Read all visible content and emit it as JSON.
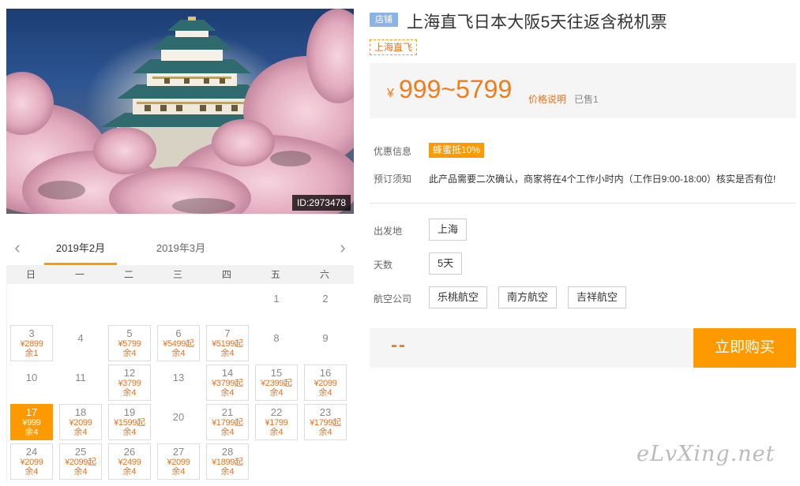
{
  "hero": {
    "image_id": "ID:2973478"
  },
  "calendar": {
    "months": [
      "2019年2月",
      "2019年3月"
    ],
    "weekdays": [
      "日",
      "一",
      "二",
      "三",
      "四",
      "五",
      "六"
    ],
    "cells": [
      {
        "day": "",
        "price": "",
        "left": ""
      },
      {
        "day": "",
        "price": "",
        "left": ""
      },
      {
        "day": "",
        "price": "",
        "left": ""
      },
      {
        "day": "",
        "price": "",
        "left": ""
      },
      {
        "day": "",
        "price": "",
        "left": ""
      },
      {
        "day": "1",
        "price": "",
        "left": ""
      },
      {
        "day": "2",
        "price": "",
        "left": ""
      },
      {
        "day": "3",
        "price": "¥2899",
        "left": "余1"
      },
      {
        "day": "4",
        "price": "",
        "left": ""
      },
      {
        "day": "5",
        "price": "¥5799",
        "left": "余4"
      },
      {
        "day": "6",
        "price": "¥5499起",
        "left": "余4"
      },
      {
        "day": "7",
        "price": "¥5199起",
        "left": "余4"
      },
      {
        "day": "8",
        "price": "",
        "left": ""
      },
      {
        "day": "9",
        "price": "",
        "left": ""
      },
      {
        "day": "10",
        "price": "",
        "left": ""
      },
      {
        "day": "11",
        "price": "",
        "left": ""
      },
      {
        "day": "12",
        "price": "¥3799",
        "left": "余4"
      },
      {
        "day": "13",
        "price": "",
        "left": ""
      },
      {
        "day": "14",
        "price": "¥3799起",
        "left": "余4"
      },
      {
        "day": "15",
        "price": "¥2399起",
        "left": "余4"
      },
      {
        "day": "16",
        "price": "¥2099",
        "left": "余4"
      },
      {
        "day": "17",
        "price": "¥999",
        "left": "余4",
        "selected": true
      },
      {
        "day": "18",
        "price": "¥2099",
        "left": "余4"
      },
      {
        "day": "19",
        "price": "¥1599起",
        "left": "余4"
      },
      {
        "day": "20",
        "price": "",
        "left": ""
      },
      {
        "day": "21",
        "price": "¥1799起",
        "left": "余4"
      },
      {
        "day": "22",
        "price": "¥1799",
        "left": "余4"
      },
      {
        "day": "23",
        "price": "¥1799起",
        "left": "余4"
      },
      {
        "day": "24",
        "price": "¥2099",
        "left": "余4"
      },
      {
        "day": "25",
        "price": "¥2099起",
        "left": "余4"
      },
      {
        "day": "26",
        "price": "¥2499",
        "left": "余4"
      },
      {
        "day": "27",
        "price": "¥2099",
        "left": "余4"
      },
      {
        "day": "28",
        "price": "¥1899起",
        "left": "余4"
      }
    ]
  },
  "product": {
    "badge": "店铺",
    "title": "上海直飞日本大阪5天往返含税机票",
    "tag": "上海直飞",
    "currency": "¥",
    "price_range": "999~5799",
    "price_explain": "价格说明",
    "sold": "已售1"
  },
  "info": {
    "promo_label": "优惠信息",
    "promo_value": "蜂蜜抵10%",
    "notice_label": "预订须知",
    "notice_value": "此产品需要二次确认，商家将在4个工作小时内（工作日9:00-18:00）核实是否有位!"
  },
  "options": {
    "departure_label": "出发地",
    "departure": [
      "上海"
    ],
    "days_label": "天数",
    "days": [
      "5天"
    ],
    "airline_label": "航空公司",
    "airlines": [
      "乐桃航空",
      "南方航空",
      "吉祥航空"
    ]
  },
  "buy": {
    "total": "--",
    "button": "立即购买"
  },
  "watermark": "eLvXing.net",
  "colors": {
    "accent": "#ff9900",
    "price": "#f07d1a",
    "badge": "#8ab4e8"
  }
}
